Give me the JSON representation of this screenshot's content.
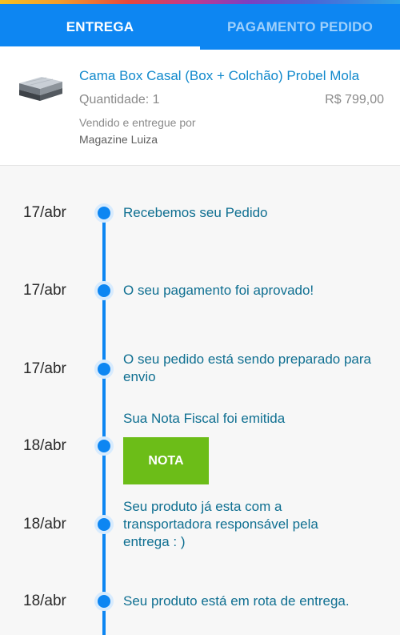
{
  "tabs": {
    "delivery": "ENTREGA",
    "payment": "PAGAMENTO PEDIDO"
  },
  "product": {
    "name": "Cama Box Casal (Box + Colchão) Probel Mola",
    "quantity": "Quantidade: 1",
    "price": "R$ 799,00",
    "sold_by_label": "Vendido e entregue por",
    "seller": "Magazine Luiza"
  },
  "timeline": [
    {
      "date": "17/abr",
      "text": "Recebemos seu Pedido"
    },
    {
      "date": "17/abr",
      "text": "O seu pagamento foi aprovado!"
    },
    {
      "date": "17/abr",
      "text": "O seu pedido está sendo preparado para envio"
    },
    {
      "date": "18/abr",
      "text": "Sua Nota Fiscal foi emitida",
      "button": "NOTA"
    },
    {
      "date": "18/abr",
      "text": "Seu produto já esta com a transportadora responsável pela entrega : )"
    },
    {
      "date": "18/abr",
      "text": "Seu produto está em rota de entrega."
    }
  ],
  "colors": {
    "primary_blue": "#0d86f2",
    "link_blue": "#1189cc",
    "event_text": "#0f6f91",
    "nota_green": "#6cbd18"
  }
}
